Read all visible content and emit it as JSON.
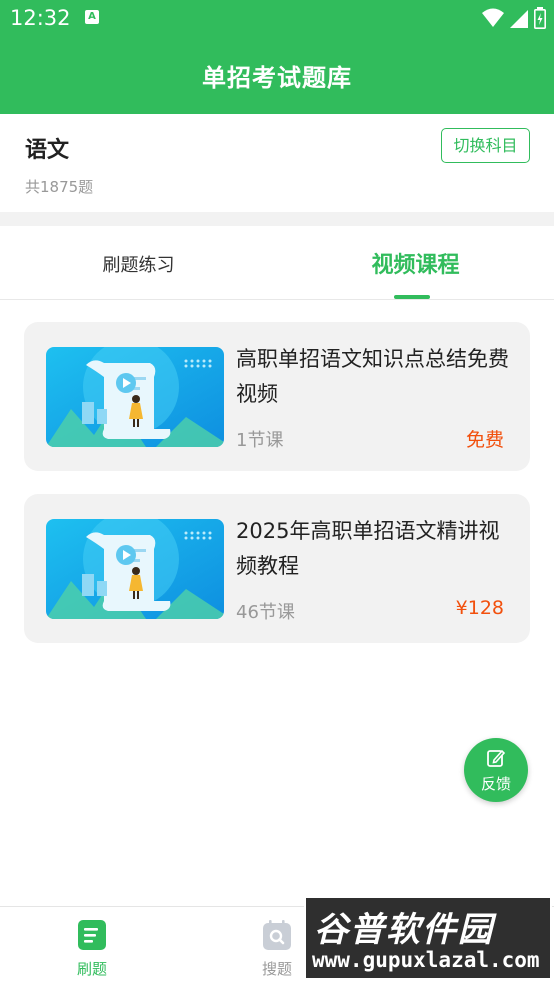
{
  "status_bar": {
    "time": "12:32",
    "indicator": "A",
    "icons": [
      "wifi-icon",
      "signal-icon",
      "battery-icon"
    ]
  },
  "app_bar": {
    "title": "单招考试题库"
  },
  "subject": {
    "name": "语文",
    "count": "共1875题",
    "switch_label": "切换科目"
  },
  "tabs": [
    {
      "label": "刷题练习",
      "active": false
    },
    {
      "label": "视频课程",
      "active": true
    }
  ],
  "courses": [
    {
      "title": "高职单招语文知识点总结免费视频",
      "lessons": "1节课",
      "price": "免费"
    },
    {
      "title": "2025年高职单招语文精讲视频教程",
      "lessons": "46节课",
      "price": "¥128"
    }
  ],
  "feedback": {
    "label": "反馈"
  },
  "bottom_nav": [
    {
      "label": "刷题",
      "icon": "document-icon",
      "active": true
    },
    {
      "label": "搜题",
      "icon": "search-icon",
      "active": false
    }
  ],
  "watermark": {
    "title": "谷普软件园",
    "url": "www.gupuxlazal.com"
  },
  "colors": {
    "brand": "#31bc5c",
    "price": "#f2500d"
  }
}
